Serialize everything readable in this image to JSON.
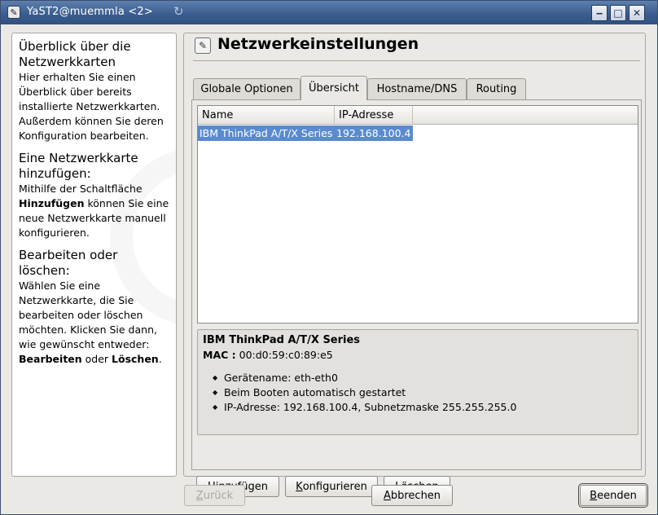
{
  "window": {
    "title": "YaST2@muemmla <2>",
    "minimize_glyph": "‒",
    "maximize_glyph": "□",
    "close_glyph": "✕"
  },
  "help": {
    "s1_title": "Überblick über die Netzwerkkarten",
    "s1_text": "Hier erhalten Sie einen Überblick über bereits installierte Netzwerkkarten. Außerdem können Sie deren Konfiguration bearbeiten.",
    "s2_title": "Eine Netzwerkkarte hinzufügen:",
    "s2_pre": "Mithilfe der Schaltfläche ",
    "s2_bold": "Hinzufügen",
    "s2_post": " können Sie eine neue Netzwerkkarte manuell konfigurieren.",
    "s3_title": "Bearbeiten oder löschen:",
    "s3_pre": "Wählen Sie eine Netzwerkkarte, die Sie bearbeiten oder löschen möchten. Klicken Sie dann, wie gewünscht entweder: ",
    "s3_bold1": "Bearbeiten",
    "s3_mid": " oder ",
    "s3_bold2": "Löschen",
    "s3_end": "."
  },
  "main": {
    "title": "Netzwerkeinstellungen",
    "tabs": [
      {
        "label": "Globale Optionen"
      },
      {
        "label": "Übersicht"
      },
      {
        "label": "Hostname/DNS"
      },
      {
        "label": "Routing"
      }
    ],
    "table": {
      "columns": [
        "Name",
        "IP-Adresse"
      ],
      "rows": [
        {
          "name": "IBM ThinkPad A/T/X Series",
          "ip": "192.168.100.4"
        }
      ]
    },
    "details": {
      "title": "IBM ThinkPad A/T/X Series",
      "mac_label": "MAC :",
      "mac_value": " 00:d0:59:c0:89:e5",
      "items": [
        "Gerätename: eth-eth0",
        "Beim Booten automatisch gestartet",
        "IP-Adresse: 192.168.100.4, Subnetzmaske 255.255.255.0"
      ]
    },
    "buttons": {
      "add_u": "H",
      "add_rest": "inzufügen",
      "configure_u": "K",
      "configure_rest": "onfigurieren",
      "delete_u": "L",
      "delete_rest": "öschen"
    }
  },
  "footer": {
    "back_u": "Z",
    "back_rest": "urück",
    "cancel_u": "A",
    "cancel_rest": "bbrechen",
    "finish_u": "B",
    "finish_rest": "eenden"
  },
  "colors": {
    "titlebar": "#3b5d8f",
    "selection": "#5a8bd0"
  }
}
